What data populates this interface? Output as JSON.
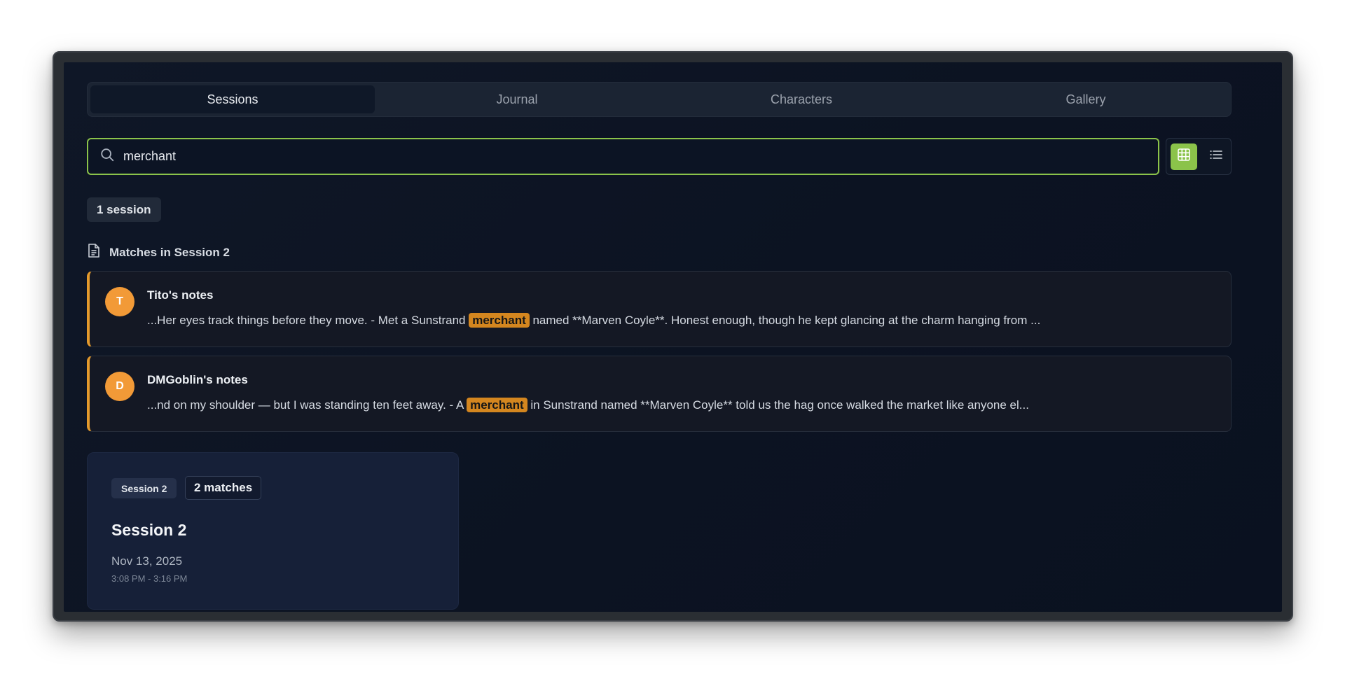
{
  "tabs": [
    {
      "label": "Sessions",
      "active": true
    },
    {
      "label": "Journal",
      "active": false
    },
    {
      "label": "Characters",
      "active": false
    },
    {
      "label": "Gallery",
      "active": false
    }
  ],
  "search": {
    "value": "merchant",
    "placeholder": ""
  },
  "view_toggle": {
    "active": "grid",
    "grid_icon": "grid-icon",
    "list_icon": "list-icon"
  },
  "results": {
    "count_label": "1 session"
  },
  "matches_section": {
    "heading": "Matches in Session 2",
    "icon": "document-icon",
    "items": [
      {
        "initial": "T",
        "author": "Tito's notes",
        "before": "...Her eyes track things before they move. - Met a Sunstrand ",
        "highlight": "merchant",
        "after": " named **Marven Coyle**. Honest enough, though he kept glancing at the charm hanging from ..."
      },
      {
        "initial": "D",
        "author": "DMGoblin's notes",
        "before": "...nd on my shoulder — but I was standing ten feet away. - A ",
        "highlight": "merchant",
        "after": " in Sunstrand named **Marven Coyle** told us the hag once walked the market like anyone el..."
      }
    ]
  },
  "session_card": {
    "tag": "Session 2",
    "matches": "2 matches",
    "title": "Session 2",
    "date": "Nov 13, 2025",
    "time": "3:08 PM - 3:16 PM"
  },
  "colors": {
    "accent_green": "#8bc34a",
    "highlight_orange": "#d4861f",
    "avatar_orange": "#f29a37"
  }
}
